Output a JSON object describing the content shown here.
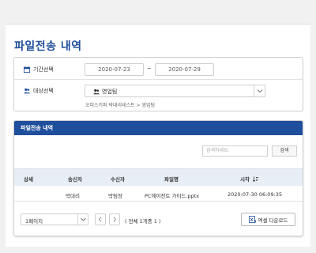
{
  "page": {
    "title": "파일전송 내역"
  },
  "filter": {
    "period_label": "기간선택",
    "date_from": "2020-07-23",
    "date_sep": "~",
    "date_to": "2020-07-29",
    "target_label": "대상선택",
    "target_value": "영업팀",
    "target_path": "오피스키퍼 박대리테스트 > 영업팀"
  },
  "list": {
    "header": "파일전송 내역",
    "search_placeholder": "검색하세요.",
    "search_button": "검색",
    "columns": [
      "상세",
      "송신자",
      "수신자",
      "파일명",
      "시각"
    ],
    "sort_icon": "sort-desc-icon",
    "rows": [
      {
        "detail": "",
        "sender": "박대리",
        "receiver": "박팀장",
        "filename": "PC에이전트 가이드.pptx",
        "time": "2020-07-30 06:09:35"
      }
    ],
    "page_select": "1페이지",
    "total": "( 전체 1개중 1 )",
    "excel_button": "엑셀 다운로드"
  },
  "colors": {
    "accent": "#1f4e9c",
    "table_header_bg": "#e8eef6"
  }
}
